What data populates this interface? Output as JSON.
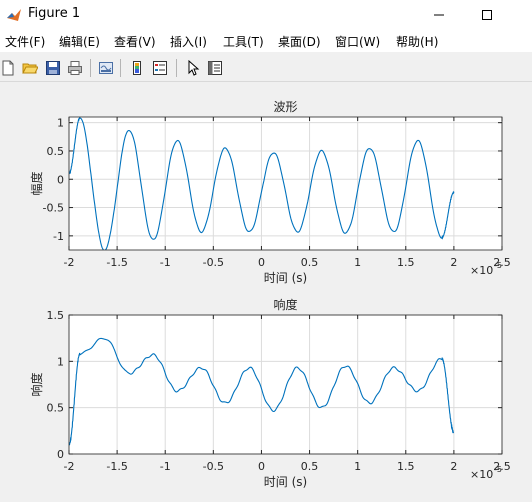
{
  "window": {
    "title": "Figure 1",
    "icons": [
      "matlab-logo-icon",
      "minimize-icon",
      "maximize-icon"
    ]
  },
  "menu": {
    "items": [
      {
        "label": "文件(F)"
      },
      {
        "label": "编辑(E)"
      },
      {
        "label": "查看(V)"
      },
      {
        "label": "插入(I)"
      },
      {
        "label": "工具(T)"
      },
      {
        "label": "桌面(D)"
      },
      {
        "label": "窗口(W)"
      },
      {
        "label": "帮助(H)"
      }
    ]
  },
  "toolbar": {
    "icons": [
      "new-figure-icon",
      "open-file-icon",
      "save-icon",
      "print-icon",
      "link-plot-icon",
      "insert-colorbar-icon",
      "insert-legend-icon",
      "edit-plot-icon",
      "property-inspector-icon"
    ]
  },
  "colors": {
    "line": "#0072bd",
    "grid": "#dcdcdc",
    "axes": "#262626"
  },
  "chart_data": [
    {
      "type": "line",
      "title": "波形",
      "xlabel": "时间 (s)",
      "ylabel": "幅度",
      "xlim": [
        -2,
        2.5
      ],
      "ylim": [
        -1.25,
        1.1
      ],
      "xticks": [
        -2,
        -1.5,
        -1,
        -0.5,
        0,
        0.5,
        1,
        1.5,
        2,
        2.5
      ],
      "xtick_labels": [
        "-2",
        "-1.5",
        "-1",
        "-0.5",
        "0",
        "0.5",
        "1",
        "1.5",
        "2",
        "2.5"
      ],
      "yticks": [
        -1,
        -0.5,
        0,
        0.5,
        1
      ],
      "ytick_labels": [
        "-1",
        "-0.5",
        "0",
        "0.5",
        "1"
      ],
      "x_exponent_label": "×10",
      "x_exponent_power": "-5",
      "grid": true,
      "series": [
        {
          "x": [
            -2,
            -1.887,
            -1.631,
            -1.375,
            -1.125,
            -0.875,
            -0.625,
            -0.375,
            -0.125,
            0.125,
            0.375,
            0.625,
            0.875,
            1.125,
            1.375,
            1.625,
            1.875,
            2
          ],
          "y": [
            0.1,
            1.08,
            -1.25,
            0.87,
            -1.07,
            0.68,
            -0.93,
            0.55,
            -0.93,
            0.47,
            -0.93,
            0.5,
            -0.95,
            0.55,
            -0.93,
            0.68,
            -1.03,
            -0.23
          ]
        }
      ]
    },
    {
      "type": "line",
      "title": "响度",
      "xlabel": "时间 (s)",
      "ylabel": "响度",
      "xlim": [
        -2,
        2.5
      ],
      "ylim": [
        0,
        1.5
      ],
      "xticks": [
        -2,
        -1.5,
        -1,
        -0.5,
        0,
        0.5,
        1,
        1.5,
        2,
        2.5
      ],
      "xtick_labels": [
        "-2",
        "-1.5",
        "-1",
        "-0.5",
        "0",
        "0.5",
        "1",
        "1.5",
        "2",
        "2.5"
      ],
      "yticks": [
        0,
        0.5,
        1,
        1.5
      ],
      "ytick_labels": [
        "0",
        "0.5",
        "1",
        "1.5"
      ],
      "x_exponent_label": "×10",
      "x_exponent_power": "-5",
      "grid": true,
      "series": [
        {
          "x": [
            -2,
            -1.887,
            -1.631,
            -1.375,
            -1.125,
            -0.875,
            -0.625,
            -0.375,
            -0.125,
            0.125,
            0.375,
            0.625,
            0.875,
            1.125,
            1.375,
            1.625,
            1.875,
            2
          ],
          "y": [
            0.1,
            1.08,
            1.25,
            0.87,
            1.07,
            0.68,
            0.93,
            0.55,
            0.93,
            0.47,
            0.93,
            0.5,
            0.95,
            0.55,
            0.93,
            0.68,
            1.03,
            0.23
          ]
        }
      ]
    }
  ]
}
